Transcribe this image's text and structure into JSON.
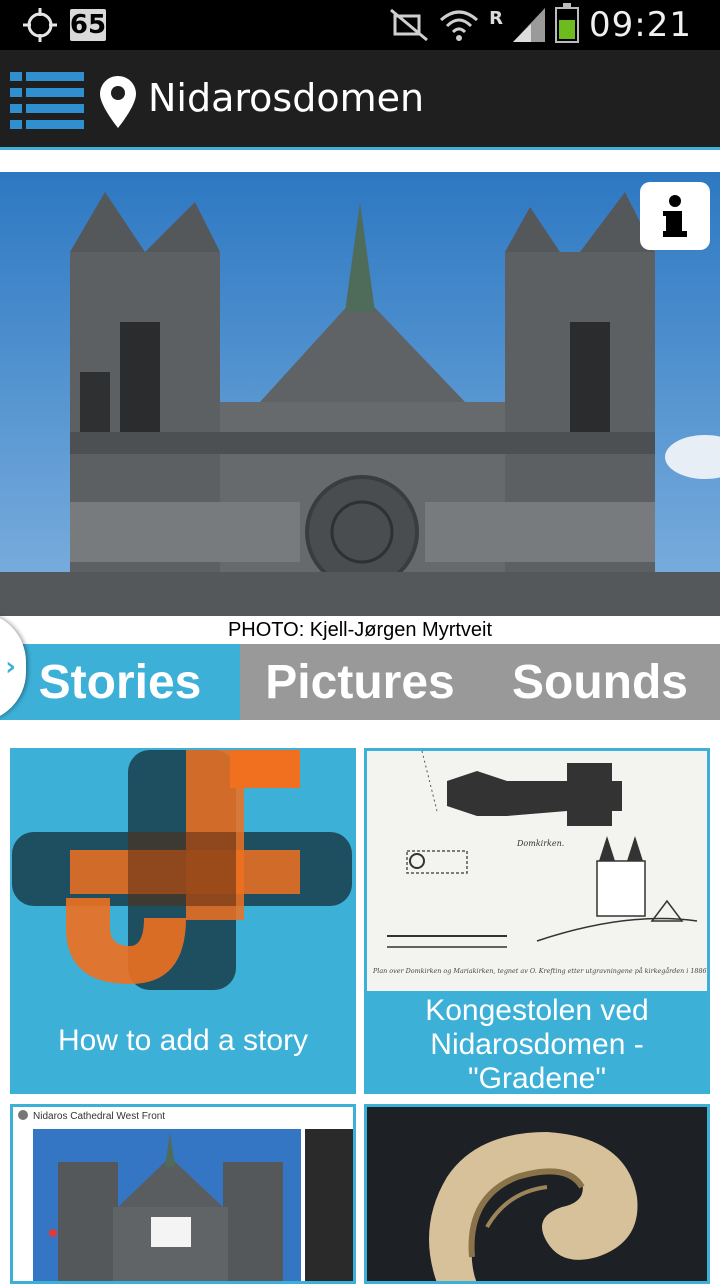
{
  "status_bar": {
    "notification_count": "65",
    "clock": "09:21",
    "roaming_label": "R",
    "icons": [
      "gps-icon",
      "mute-icon",
      "wifi-icon",
      "signal-icon",
      "battery-icon"
    ],
    "battery_level": 0.6
  },
  "action_bar": {
    "title": "Nidarosdomen",
    "menu_icon": "menu-list-icon",
    "location_icon": "map-pin-icon",
    "accent_color": "#3fb0d6"
  },
  "hero": {
    "photo_credit": "PHOTO: Kjell-Jørgen Myrtveit",
    "info_icon": "info-icon"
  },
  "tabs": [
    {
      "label": "Stories",
      "active": true
    },
    {
      "label": "Pictures",
      "active": false
    },
    {
      "label": "Sounds",
      "active": false
    }
  ],
  "colors": {
    "tab_active": "#3db0d8",
    "tab_inactive": "#999999",
    "logo_blue": "#1b4a5a",
    "logo_orange": "#f07020"
  },
  "cards": [
    {
      "caption": "How to add a story"
    },
    {
      "caption": "Kongestolen ved Nidarosdomen - \"Gradene\""
    },
    {
      "caption": ""
    },
    {
      "caption": ""
    }
  ],
  "card_images": {
    "map_caption": "Plan over Domkirken og Mariakirken, tegnet av O. Krefting etter utgravningene på kirkegården i 1886.",
    "map_label": "Domkirken.",
    "screenshot_title": "Nidaros Cathedral West Front"
  }
}
